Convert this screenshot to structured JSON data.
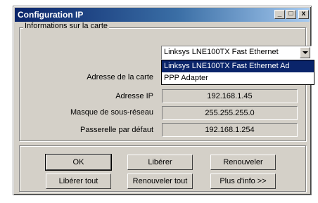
{
  "window": {
    "title": "Configuration IP",
    "controls": {
      "minimize": "_",
      "maximize": "□",
      "close": "x"
    }
  },
  "group": {
    "label": "Informations sur la carte"
  },
  "adapter": {
    "selected": "Linksys LNE100TX Fast Ethernet",
    "options": [
      "Linksys LNE100TX Fast Ethernet Ad",
      "PPP Adapter"
    ]
  },
  "fields": {
    "mac_label": "Adresse de la carte",
    "mac_value": "",
    "ip_label": "Adresse IP",
    "ip_value": "192.168.1.45",
    "mask_label": "Masque de sous-réseau",
    "mask_value": "255.255.255.0",
    "gateway_label": "Passerelle par défaut",
    "gateway_value": "192.168.1.254"
  },
  "buttons": {
    "ok": "OK",
    "release": "Libérer",
    "renew": "Renouveler",
    "release_all": "Libérer tout",
    "renew_all": "Renouveler tout",
    "more_info": "Plus d'info >>"
  }
}
